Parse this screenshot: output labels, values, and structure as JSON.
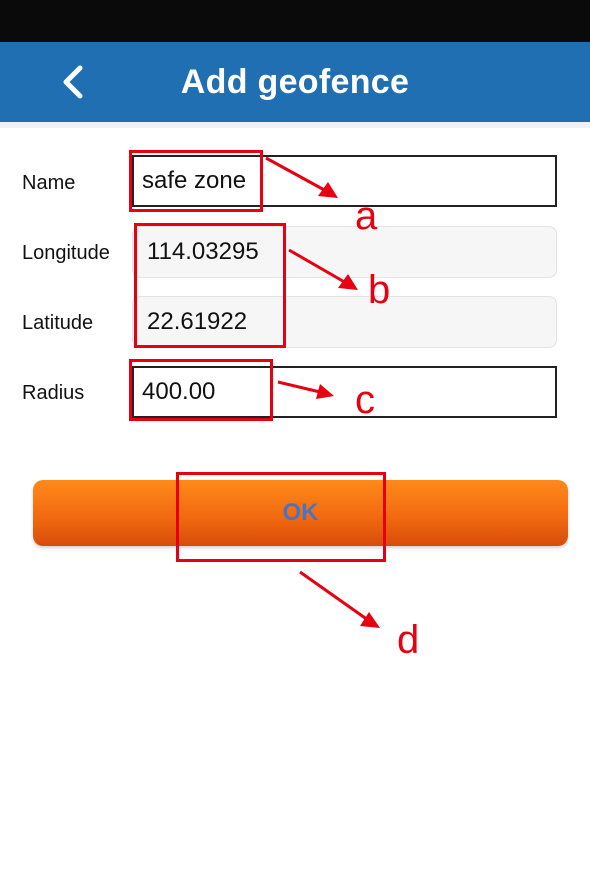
{
  "header": {
    "title": "Add geofence",
    "back_icon": "chevron-left-icon"
  },
  "form": {
    "name": {
      "label": "Name",
      "value": "safe zone"
    },
    "longitude": {
      "label": "Longitude",
      "value": "114.03295"
    },
    "latitude": {
      "label": "Latitude",
      "value": "22.61922"
    },
    "radius": {
      "label": "Radius",
      "value": "400.00"
    }
  },
  "ok_button": {
    "label": "OK"
  },
  "annotations": {
    "a": "a",
    "b": "b",
    "c": "c",
    "d": "d",
    "color": "#e60012"
  },
  "colors": {
    "topbar": "#1f6fb2",
    "button_top": "#ff8a1a",
    "button_bottom": "#d84c0a",
    "button_text": "#4a74c0"
  }
}
